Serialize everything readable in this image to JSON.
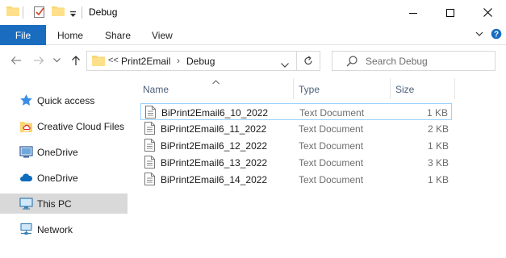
{
  "window": {
    "title": "Debug",
    "controls": [
      "minimize",
      "maximize",
      "close"
    ]
  },
  "ribbon": {
    "tabs": [
      {
        "label": "File",
        "active": true
      },
      {
        "label": "Home"
      },
      {
        "label": "Share"
      },
      {
        "label": "View"
      }
    ]
  },
  "address": {
    "overflow": "<<",
    "segments": [
      "Print2Email",
      "Debug"
    ],
    "separator": "›"
  },
  "search": {
    "placeholder": "Search Debug"
  },
  "nav_pane": {
    "items": [
      {
        "label": "Quick access",
        "icon": "star-icon"
      },
      {
        "label": "Creative Cloud Files",
        "icon": "creative-cloud-folder-icon"
      },
      {
        "label": "OneDrive",
        "icon": "onedrive-personal-icon"
      },
      {
        "label": "OneDrive",
        "icon": "onedrive-cloud-icon"
      },
      {
        "label": "This PC",
        "icon": "computer-icon",
        "selected": true
      },
      {
        "label": "Network",
        "icon": "network-icon"
      }
    ]
  },
  "columns": {
    "name": "Name",
    "type": "Type",
    "size": "Size"
  },
  "files": [
    {
      "name": "BiPrint2Email6_10_2022",
      "type": "Text Document",
      "size": "1 KB"
    },
    {
      "name": "BiPrint2Email6_11_2022",
      "type": "Text Document",
      "size": "2 KB"
    },
    {
      "name": "BiPrint2Email6_12_2022",
      "type": "Text Document",
      "size": "1 KB"
    },
    {
      "name": "BiPrint2Email6_13_2022",
      "type": "Text Document",
      "size": "3 KB"
    },
    {
      "name": "BiPrint2Email6_14_2022",
      "type": "Text Document",
      "size": "1 KB"
    }
  ],
  "colors": {
    "accent": "#1a6cbf",
    "selection": "#d9d9d9",
    "focus_border": "#99d1ff",
    "folder": "#f8d775"
  }
}
